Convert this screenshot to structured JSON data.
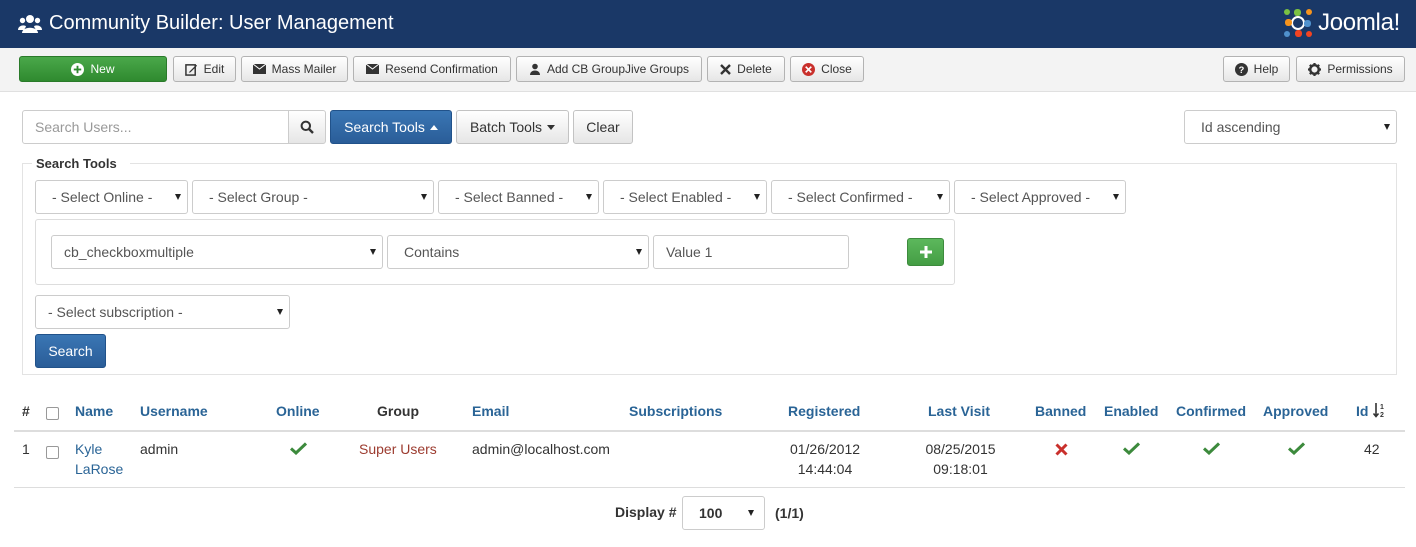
{
  "header": {
    "title": "Community Builder: User Management",
    "brand": "Joomla!"
  },
  "toolbar": {
    "new": "New",
    "edit": "Edit",
    "mass_mailer": "Mass Mailer",
    "resend": "Resend Confirmation",
    "groupjive": "Add CB GroupJive Groups",
    "delete": "Delete",
    "close": "Close",
    "help": "Help",
    "permissions": "Permissions"
  },
  "search": {
    "placeholder": "Search Users...",
    "search_tools": "Search Tools",
    "batch_tools": "Batch Tools",
    "clear": "Clear",
    "ordering": "Id ascending"
  },
  "search_tools": {
    "legend": "Search Tools",
    "filters": {
      "online": "- Select Online -",
      "group": "- Select Group -",
      "banned": "- Select Banned -",
      "enabled": "- Select Enabled -",
      "confirmed": "- Select Confirmed -",
      "approved": "- Select Approved -"
    },
    "field": "cb_checkboxmultiple",
    "operator": "Contains",
    "value": "Value 1",
    "subscription": "- Select subscription -",
    "search_button": "Search"
  },
  "table": {
    "columns": [
      "#",
      "Name",
      "Username",
      "Online",
      "Group",
      "Email",
      "Subscriptions",
      "Registered",
      "Last Visit",
      "Banned",
      "Enabled",
      "Confirmed",
      "Approved",
      "Id"
    ],
    "rows": [
      {
        "num": "1",
        "name_line1": "Kyle",
        "name_line2": "LaRose",
        "username": "admin",
        "online": "yes",
        "group": "Super Users",
        "email": "admin@localhost.com",
        "subscriptions": "",
        "registered_date": "01/26/2012",
        "registered_time": "14:44:04",
        "last_visit_date": "08/25/2015",
        "last_visit_time": "09:18:01",
        "banned": "no",
        "enabled": "yes",
        "confirmed": "yes",
        "approved": "yes",
        "id": "42"
      }
    ]
  },
  "pagination": {
    "display_label": "Display #",
    "display_value": "100",
    "pages": "(1/1)"
  },
  "colors": {
    "header_bg": "#1a3867",
    "link": "#2a6496",
    "check_green": "#3c8a3c",
    "cross_red": "#c9302c",
    "group_text": "#9c3b2f"
  }
}
